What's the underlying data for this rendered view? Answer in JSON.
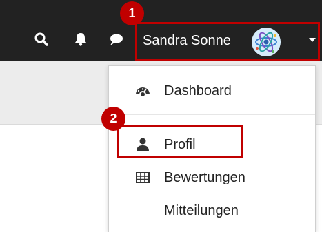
{
  "header": {
    "icons": [
      "search-icon",
      "bell-icon",
      "chat-icon"
    ],
    "user": {
      "name": "Sandra Sonne",
      "avatar_icon": "atom-avatar-icon"
    }
  },
  "dropdown": {
    "items": [
      {
        "label": "Dashboard",
        "icon": "dashboard-gauge-icon"
      },
      {
        "label": "Profil",
        "icon": "user-icon"
      },
      {
        "label": "Bewertungen",
        "icon": "table-grid-icon"
      },
      {
        "label": "Mitteilungen",
        "icon": ""
      }
    ]
  },
  "annotations": {
    "badge_1": "1",
    "badge_2": "2",
    "color": "#c00000"
  },
  "colors": {
    "topbar": "#222222",
    "subbar": "#ececec"
  }
}
